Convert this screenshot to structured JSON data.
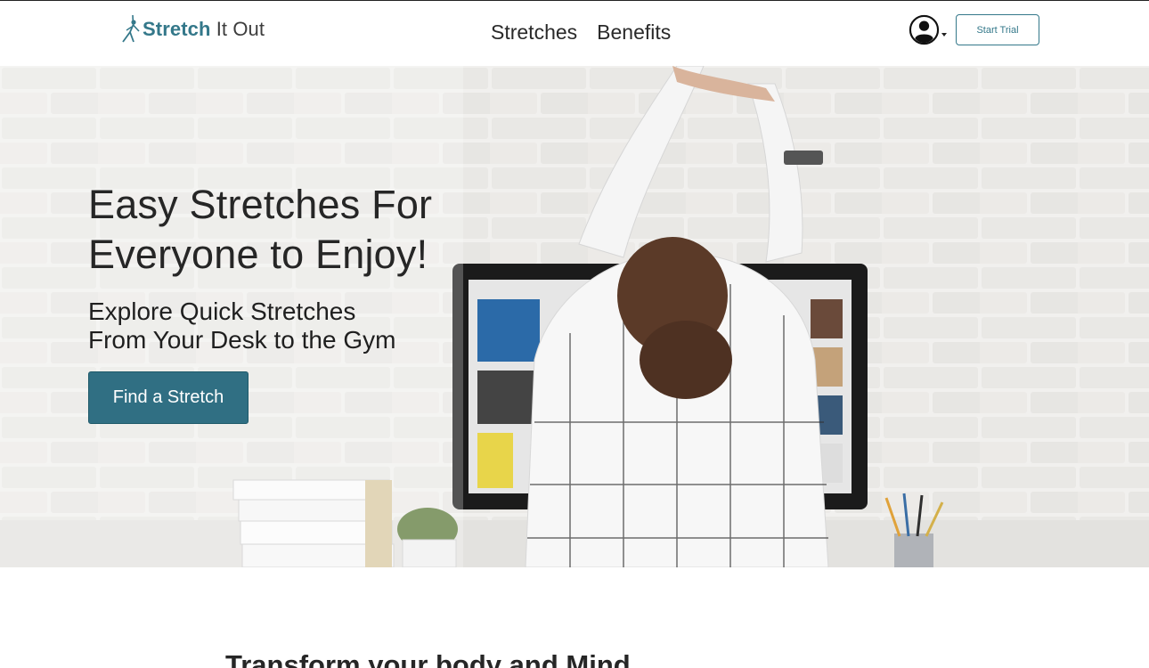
{
  "header": {
    "logo": {
      "strong": "Stretch",
      "light": " It Out",
      "icon": "stretching-person-icon"
    },
    "nav": [
      {
        "label": "Stretches"
      },
      {
        "label": "Benefits"
      }
    ],
    "account_icon": "user-circle-icon",
    "start_trial_label": "Start Trial"
  },
  "hero": {
    "title_line1": "Easy Stretches For",
    "title_line2": "Everyone to Enjoy!",
    "subtitle_line1": "Explore Quick Stretches",
    "subtitle_line2": "From Your Desk to the Gym",
    "button_label": "Find a Stretch",
    "image_alt": "woman stretching arms at desk"
  },
  "section": {
    "title": "Transform your body and Mind"
  },
  "colors": {
    "brand": "#34788a",
    "button_bg": "#306f83",
    "text": "#262626"
  }
}
